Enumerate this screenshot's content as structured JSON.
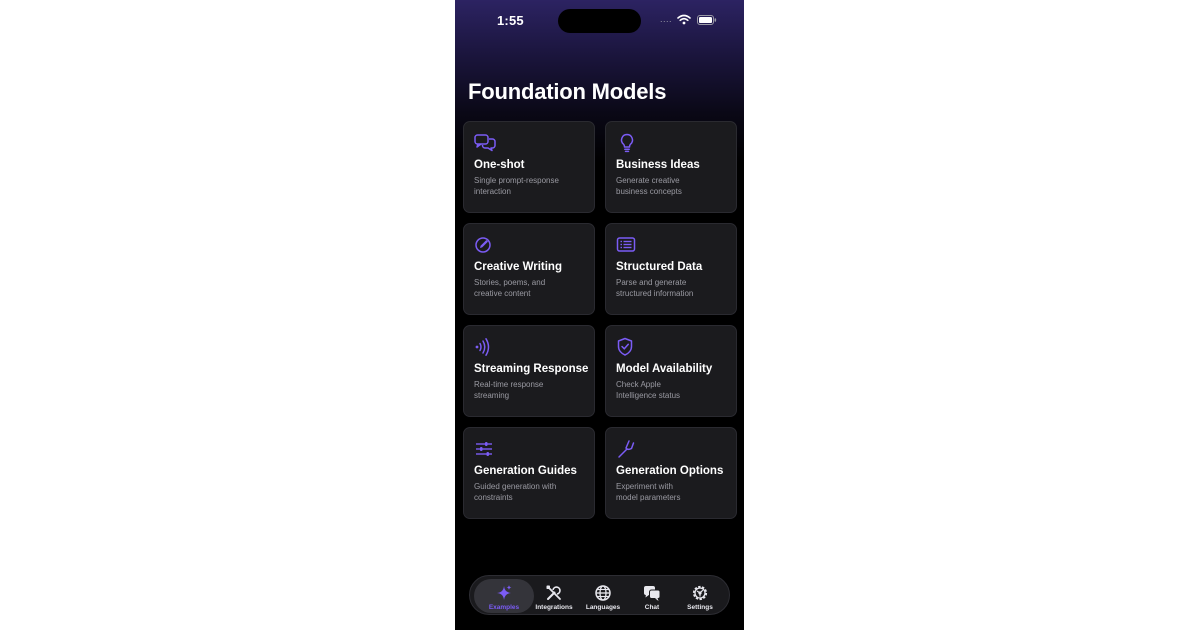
{
  "status_bar": {
    "time": "1:55",
    "signal": "....",
    "icons": [
      "wifi-icon",
      "battery-icon"
    ]
  },
  "page": {
    "title": "Foundation Models"
  },
  "accent_color": "#7b5cf5",
  "cards": [
    {
      "icon": "chat-bubbles-icon",
      "title": "One-shot",
      "desc_line1": "Single prompt-response",
      "desc_line2": "interaction"
    },
    {
      "icon": "lightbulb-icon",
      "title": "Business Ideas",
      "desc_line1": "Generate creative",
      "desc_line2": "business concepts"
    },
    {
      "icon": "pencil-circle-icon",
      "title": "Creative Writing",
      "desc_line1": "Stories, poems, and",
      "desc_line2": "creative content"
    },
    {
      "icon": "text-document-icon",
      "title": "Structured Data",
      "desc_line1": "Parse and generate",
      "desc_line2": "structured information"
    },
    {
      "icon": "wave-signal-icon",
      "title": "Streaming Response",
      "desc_line1": "Real-time response",
      "desc_line2": "streaming"
    },
    {
      "icon": "shield-check-icon",
      "title": "Model Availability",
      "desc_line1": "Check Apple",
      "desc_line2": "Intelligence status"
    },
    {
      "icon": "sliders-icon",
      "title": "Generation Guides",
      "desc_line1": "Guided generation with",
      "desc_line2": "constraints"
    },
    {
      "icon": "tuning-fork-icon",
      "title": "Generation Options",
      "desc_line1": "Experiment with",
      "desc_line2": "model parameters"
    }
  ],
  "tabs": [
    {
      "icon": "sparkles-icon",
      "label": "Examples",
      "active": true
    },
    {
      "icon": "tools-icon",
      "label": "Integrations",
      "active": false
    },
    {
      "icon": "globe-icon",
      "label": "Languages",
      "active": false
    },
    {
      "icon": "chat-icon",
      "label": "Chat",
      "active": false
    },
    {
      "icon": "gear-icon",
      "label": "Settings",
      "active": false
    }
  ]
}
